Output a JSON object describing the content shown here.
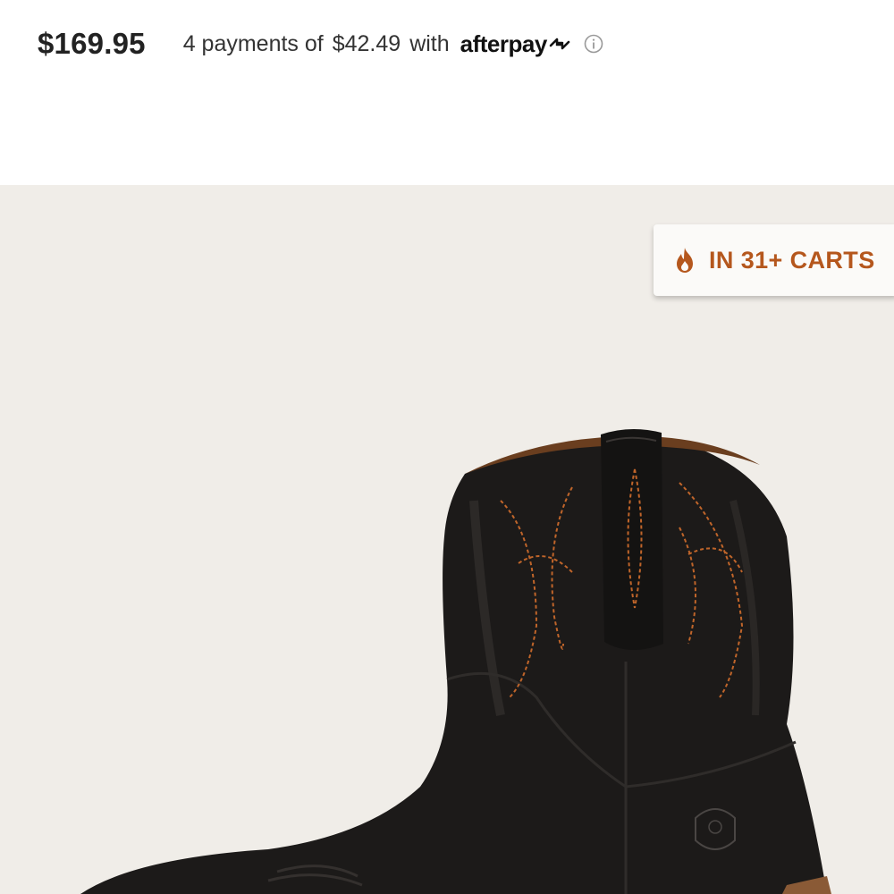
{
  "product": {
    "price": "$169.95",
    "afterpay": {
      "prefix": "4 payments of",
      "amount": "$42.49",
      "suffix": "with",
      "brand": "afterpay",
      "info_icon": "info-icon"
    },
    "image": {
      "badge_text": "IN 31+ CARTS",
      "badge_icon": "flame-icon",
      "badge_color": "#b5571d",
      "background_color": "#f0ede8"
    }
  }
}
